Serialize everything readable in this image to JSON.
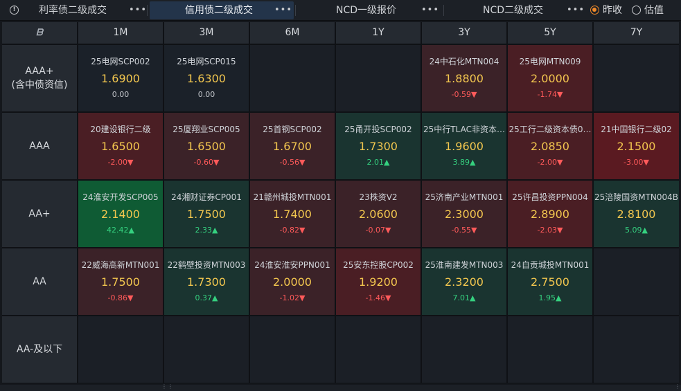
{
  "tabs": [
    {
      "label": "利率债二级成交",
      "active": false
    },
    {
      "label": "信用债二级成交",
      "active": true
    },
    {
      "label": "NCD一级报价",
      "active": false
    },
    {
      "label": "NCD二级成交",
      "active": false
    }
  ],
  "more_glyph": "•••",
  "info_glyph": "!",
  "radios": [
    {
      "label": "昨收",
      "selected": true
    },
    {
      "label": "估值",
      "selected": false
    }
  ],
  "corner_icon": "ᗷ",
  "tenors": [
    "1M",
    "3M",
    "6M",
    "1Y",
    "3Y",
    "5Y",
    "7Y"
  ],
  "ratings": [
    "AAA+\n(含中债资信)",
    "AAA",
    "AA+",
    "AA",
    "AA-及以下"
  ],
  "colors": {
    "neutral": "#1b2129",
    "red_light": "#3b2228",
    "red_mid": "#4a1e24",
    "red_strong": "#5a1a21",
    "green_light": "#1a3430",
    "green_strong": "#0f5b34",
    "price": "#f3c74f",
    "change_up": "#35d07f",
    "change_down": "#ff5a5a",
    "radio_on": "#f08a2a"
  },
  "rows": [
    [
      {
        "name": "25电网SCP002",
        "price": "1.6900",
        "change": "0.00",
        "dir": "zero",
        "bg": "neutral"
      },
      {
        "name": "25电网SCP015",
        "price": "1.6300",
        "change": "0.00",
        "dir": "zero",
        "bg": "neutral"
      },
      null,
      null,
      {
        "name": "24中石化MTN004",
        "price": "1.8800",
        "change": "-0.59▼",
        "dir": "neg",
        "bg": "red_light"
      },
      {
        "name": "25电网MTN009",
        "price": "2.0000",
        "change": "-1.74▼",
        "dir": "neg",
        "bg": "red_mid"
      },
      null
    ],
    [
      {
        "name": "20建设银行二级",
        "price": "1.6500",
        "change": "-2.00▼",
        "dir": "neg",
        "bg": "red_mid"
      },
      {
        "name": "25厦翔业SCP005",
        "price": "1.6500",
        "change": "-0.60▼",
        "dir": "neg",
        "bg": "red_light"
      },
      {
        "name": "25首钢SCP002",
        "price": "1.6700",
        "change": "-0.56▼",
        "dir": "neg",
        "bg": "red_light"
      },
      {
        "name": "25甬开投SCP002",
        "price": "1.7300",
        "change": "2.01▲",
        "dir": "pos",
        "bg": "green_light"
      },
      {
        "name": "25中行TLAC非资本…",
        "price": "1.9600",
        "change": "3.89▲",
        "dir": "pos",
        "bg": "green_light"
      },
      {
        "name": "25工行二级资本债0…",
        "price": "2.0850",
        "change": "-2.00▼",
        "dir": "neg",
        "bg": "red_mid"
      },
      {
        "name": "21中国银行二级02",
        "price": "2.1500",
        "change": "-3.00▼",
        "dir": "neg",
        "bg": "red_strong"
      }
    ],
    [
      {
        "name": "24淮安开发SCP005",
        "price": "2.1400",
        "change": "42.42▲",
        "dir": "pos",
        "bg": "green_strong"
      },
      {
        "name": "24湘财证券CP001",
        "price": "1.7500",
        "change": "2.33▲",
        "dir": "pos",
        "bg": "green_light"
      },
      {
        "name": "21赣州城投MTN001",
        "price": "1.7400",
        "change": "-0.82▼",
        "dir": "neg",
        "bg": "red_light"
      },
      {
        "name": "23株资V2",
        "price": "2.0600",
        "change": "-0.07▼",
        "dir": "neg",
        "bg": "red_light"
      },
      {
        "name": "25济南产业MTN001",
        "price": "2.3000",
        "change": "-0.55▼",
        "dir": "neg",
        "bg": "red_light"
      },
      {
        "name": "25许昌投资PPN004",
        "price": "2.8900",
        "change": "-2.03▼",
        "dir": "neg",
        "bg": "red_mid"
      },
      {
        "name": "25涪陵国资MTN004B",
        "price": "2.8100",
        "change": "5.09▲",
        "dir": "pos",
        "bg": "green_light"
      }
    ],
    [
      {
        "name": "22威海高新MTN001",
        "price": "1.7500",
        "change": "-0.86▼",
        "dir": "neg",
        "bg": "red_light"
      },
      {
        "name": "22鹤壁投资MTN003",
        "price": "1.7300",
        "change": "0.37▲",
        "dir": "pos",
        "bg": "green_light"
      },
      {
        "name": "24淮安淮安PPN001",
        "price": "2.0000",
        "change": "-1.02▼",
        "dir": "neg",
        "bg": "red_light"
      },
      {
        "name": "25安东控股CP002",
        "price": "1.9200",
        "change": "-1.46▼",
        "dir": "neg",
        "bg": "red_mid"
      },
      {
        "name": "25淮南建发MTN003",
        "price": "2.3200",
        "change": "7.01▲",
        "dir": "pos",
        "bg": "green_light"
      },
      {
        "name": "24自贡城投MTN001",
        "price": "2.7500",
        "change": "1.95▲",
        "dir": "pos",
        "bg": "green_light"
      },
      null
    ],
    [
      null,
      null,
      null,
      null,
      null,
      null,
      null
    ]
  ]
}
